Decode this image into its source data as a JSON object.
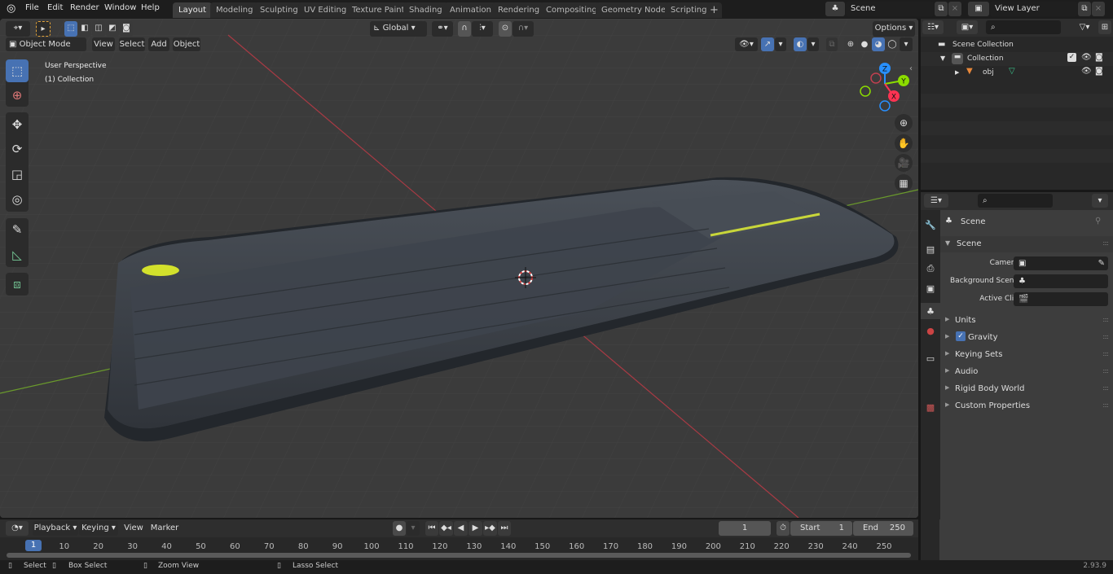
{
  "app": {
    "version": "2.93.9"
  },
  "menu": [
    "File",
    "Edit",
    "Render",
    "Window",
    "Help"
  ],
  "workspaces": [
    "Layout",
    "Modeling",
    "Sculpting",
    "UV Editing",
    "Texture Paint",
    "Shading",
    "Animation",
    "Rendering",
    "Compositing",
    "Geometry Nodes",
    "Scripting"
  ],
  "active_workspace": "Layout",
  "add_workspace": "+",
  "scene_selector": {
    "value": "Scene"
  },
  "viewlayer_selector": {
    "value": "View Layer"
  },
  "viewport": {
    "mode": "Object Mode",
    "menus": [
      "View",
      "Select",
      "Add",
      "Object"
    ],
    "orientation": "Global",
    "options_label": "Options",
    "overlay_title": "User Perspective",
    "overlay_collection": "(1) Collection",
    "gizmo_axes": [
      "Z",
      "Y",
      "X"
    ]
  },
  "toolbar_tools": [
    "select-box",
    "cursor",
    "move",
    "rotate",
    "scale",
    "transform",
    "annotate",
    "measure",
    "add-cube"
  ],
  "outliner": {
    "root": "Scene Collection",
    "items": [
      {
        "label": "Collection",
        "type": "collection",
        "expanded": true,
        "checked": true
      },
      {
        "label": "obj",
        "type": "mesh-object",
        "expanded": false
      }
    ]
  },
  "properties": {
    "header": "Scene",
    "panel_title": "Scene",
    "fields": [
      {
        "label": "Camera",
        "value": ""
      },
      {
        "label": "Background Scene",
        "value": ""
      },
      {
        "label": "Active Clip",
        "value": ""
      }
    ],
    "subpanels": [
      "Units",
      "Gravity",
      "Keying Sets",
      "Audio",
      "Rigid Body World",
      "Custom Properties"
    ],
    "gravity_enabled": true
  },
  "timeline": {
    "menus": [
      "Playback",
      "Keying",
      "View",
      "Marker"
    ],
    "current_frame": "1",
    "start_label": "Start",
    "start": "1",
    "end_label": "End",
    "end": "250",
    "ticks": [
      "10",
      "20",
      "30",
      "40",
      "50",
      "60",
      "70",
      "80",
      "90",
      "100",
      "110",
      "120",
      "130",
      "140",
      "150",
      "160",
      "170",
      "180",
      "190",
      "200",
      "210",
      "220",
      "230",
      "240",
      "250"
    ]
  },
  "statusbar": {
    "hints": [
      "Select",
      "Box Select",
      "Zoom View",
      "Lasso Select"
    ]
  },
  "colors": {
    "accent": "#4772b3",
    "x_axis": "#ff3352",
    "y_axis": "#8bdc00",
    "z_axis": "#2890ff",
    "object_orange": "#e8883a"
  }
}
